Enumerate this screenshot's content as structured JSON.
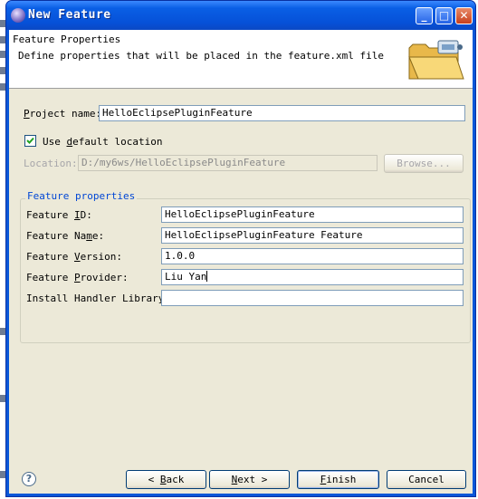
{
  "window": {
    "title": "New Feature",
    "controls": {
      "minimize": "_",
      "maximize": "□",
      "close": "✕"
    }
  },
  "header": {
    "title": "Feature Properties",
    "description": "Define properties that will be placed in the feature.xml file"
  },
  "project": {
    "name_label_first": "P",
    "name_label_rest": "roject name:",
    "name_value": "HelloEclipsePluginFeature",
    "use_default_pre": "Use ",
    "use_default_u": "d",
    "use_default_post": "efault location",
    "use_default_checked": true,
    "location_label": "Location:",
    "location_value": "D:/my6ws/HelloEclipsePluginFeature",
    "browse_label": "Browse..."
  },
  "feature_properties": {
    "group_title": "Feature properties",
    "fields": [
      {
        "pre": "Feature ",
        "u": "I",
        "post": "D:",
        "value": "HelloEclipsePluginFeature"
      },
      {
        "pre": "Feature Na",
        "u": "m",
        "post": "e:",
        "value": "HelloEclipsePluginFeature Feature"
      },
      {
        "pre": "Feature ",
        "u": "V",
        "post": "ersion:",
        "value": "1.0.0"
      },
      {
        "pre": "Feature ",
        "u": "P",
        "post": "rovider:",
        "value": "Liu Yan"
      },
      {
        "pre": "Install Handler Library:",
        "u": "",
        "post": "",
        "value": ""
      }
    ]
  },
  "footer": {
    "help_icon": "?",
    "back_pre": "< ",
    "back_u": "B",
    "back_post": "ack",
    "next_u": "N",
    "next_post": "ext >",
    "finish_u": "F",
    "finish_post": "inish",
    "cancel_label": "Cancel"
  },
  "colors": {
    "title_bar": "#0a5fe5",
    "dialog_bg": "#ece9d8",
    "group_title": "#0046d5"
  }
}
